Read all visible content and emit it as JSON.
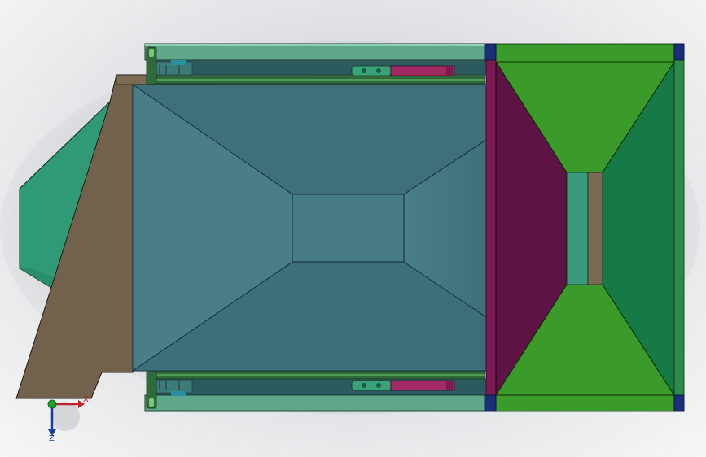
{
  "colors": {
    "background": "#d3d6da",
    "hopper_inner": "#3f6f7d",
    "hopper_face_light": "#4a7a88",
    "funnel_green": "#2f9a75",
    "support_brown": "#72614b",
    "frame_green": "#5fa78a",
    "rail_dark": "#2e6a3a",
    "magenta_panel": "#5d1444",
    "bright_green": "#3a9a2a",
    "dark_green": "#167a46",
    "outlet_teal": "#3a9a7c",
    "outlet_brown": "#7a6a55",
    "corner_blue": "#1a2e7a",
    "axis_x_color": "#c0202a",
    "axis_y_color": "#1a3aa0",
    "axis_origin_color": "#1fa02a"
  },
  "axis_triad": {
    "x_label": "X",
    "y_label": "Z"
  },
  "parts": [
    "hopper-body",
    "feed-funnel",
    "support-plate",
    "top-frame-rail",
    "bottom-frame-rail",
    "discharge-chute",
    "magenta-side-panel",
    "drive-unit-top",
    "drive-unit-bottom"
  ]
}
